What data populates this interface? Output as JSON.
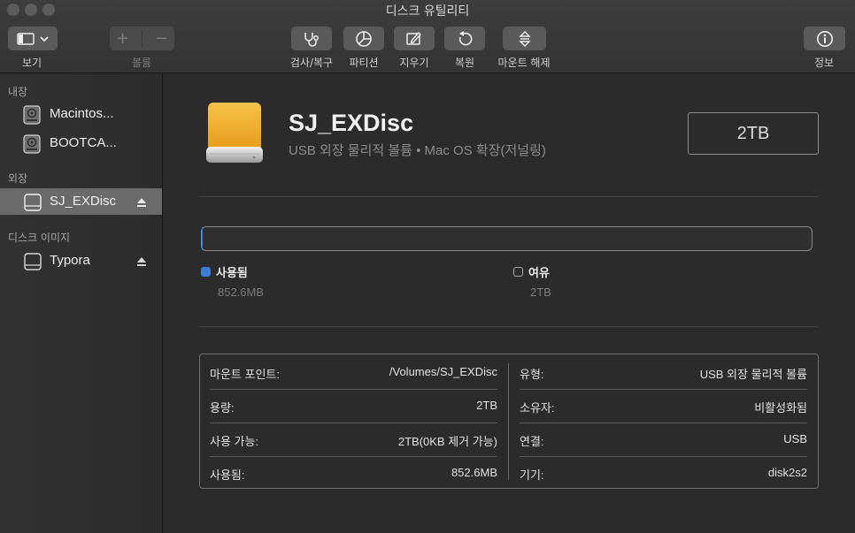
{
  "window": {
    "title": "디스크 유틸리티"
  },
  "toolbar": {
    "view_label": "보기",
    "volume_label": "볼륨",
    "firstaid_label": "검사/복구",
    "partition_label": "파티션",
    "erase_label": "지우기",
    "restore_label": "복원",
    "unmount_label": "마운트 해제",
    "info_label": "정보",
    "plus_glyph": "+",
    "minus_glyph": "−"
  },
  "sidebar": {
    "internal_title": "내장",
    "external_title": "외장",
    "images_title": "디스크 이미지",
    "internal_items": [
      {
        "label": "Macintos..."
      },
      {
        "label": "BOOTCA..."
      }
    ],
    "external_items": [
      {
        "label": "SJ_EXDisc"
      }
    ],
    "image_items": [
      {
        "label": "Typora"
      }
    ]
  },
  "volume": {
    "name": "SJ_EXDisc",
    "subtitle": "USB 외장 물리적 볼륨 • Mac OS 확장(저널링)",
    "capacity": "2TB"
  },
  "usage": {
    "used_label": "사용됨",
    "used_value": "852.6MB",
    "free_label": "여유",
    "free_value": "2TB",
    "used_fraction": 0.0004,
    "used_color": "#3b7bd4",
    "free_color": "#2b2b2b"
  },
  "info": {
    "left": [
      {
        "key": "마운트 포인트:",
        "value": "/Volumes/SJ_EXDisc"
      },
      {
        "key": "용량:",
        "value": "2TB"
      },
      {
        "key": "사용 가능:",
        "value": "2TB(0KB 제거 가능)"
      },
      {
        "key": "사용됨:",
        "value": "852.6MB"
      }
    ],
    "right": [
      {
        "key": "유형:",
        "value": "USB 외장 물리적 볼륨"
      },
      {
        "key": "소유자:",
        "value": "비활성화됨"
      },
      {
        "key": "연결:",
        "value": "USB"
      },
      {
        "key": "기기:",
        "value": "disk2s2"
      }
    ]
  },
  "icons": {
    "view": "sidebar-toggle-icon",
    "firstaid": "stethoscope-icon",
    "partition": "pie-icon",
    "erase": "pencil-icon",
    "restore": "restore-icon",
    "unmount": "eject-arrows-icon",
    "info": "info-icon"
  }
}
